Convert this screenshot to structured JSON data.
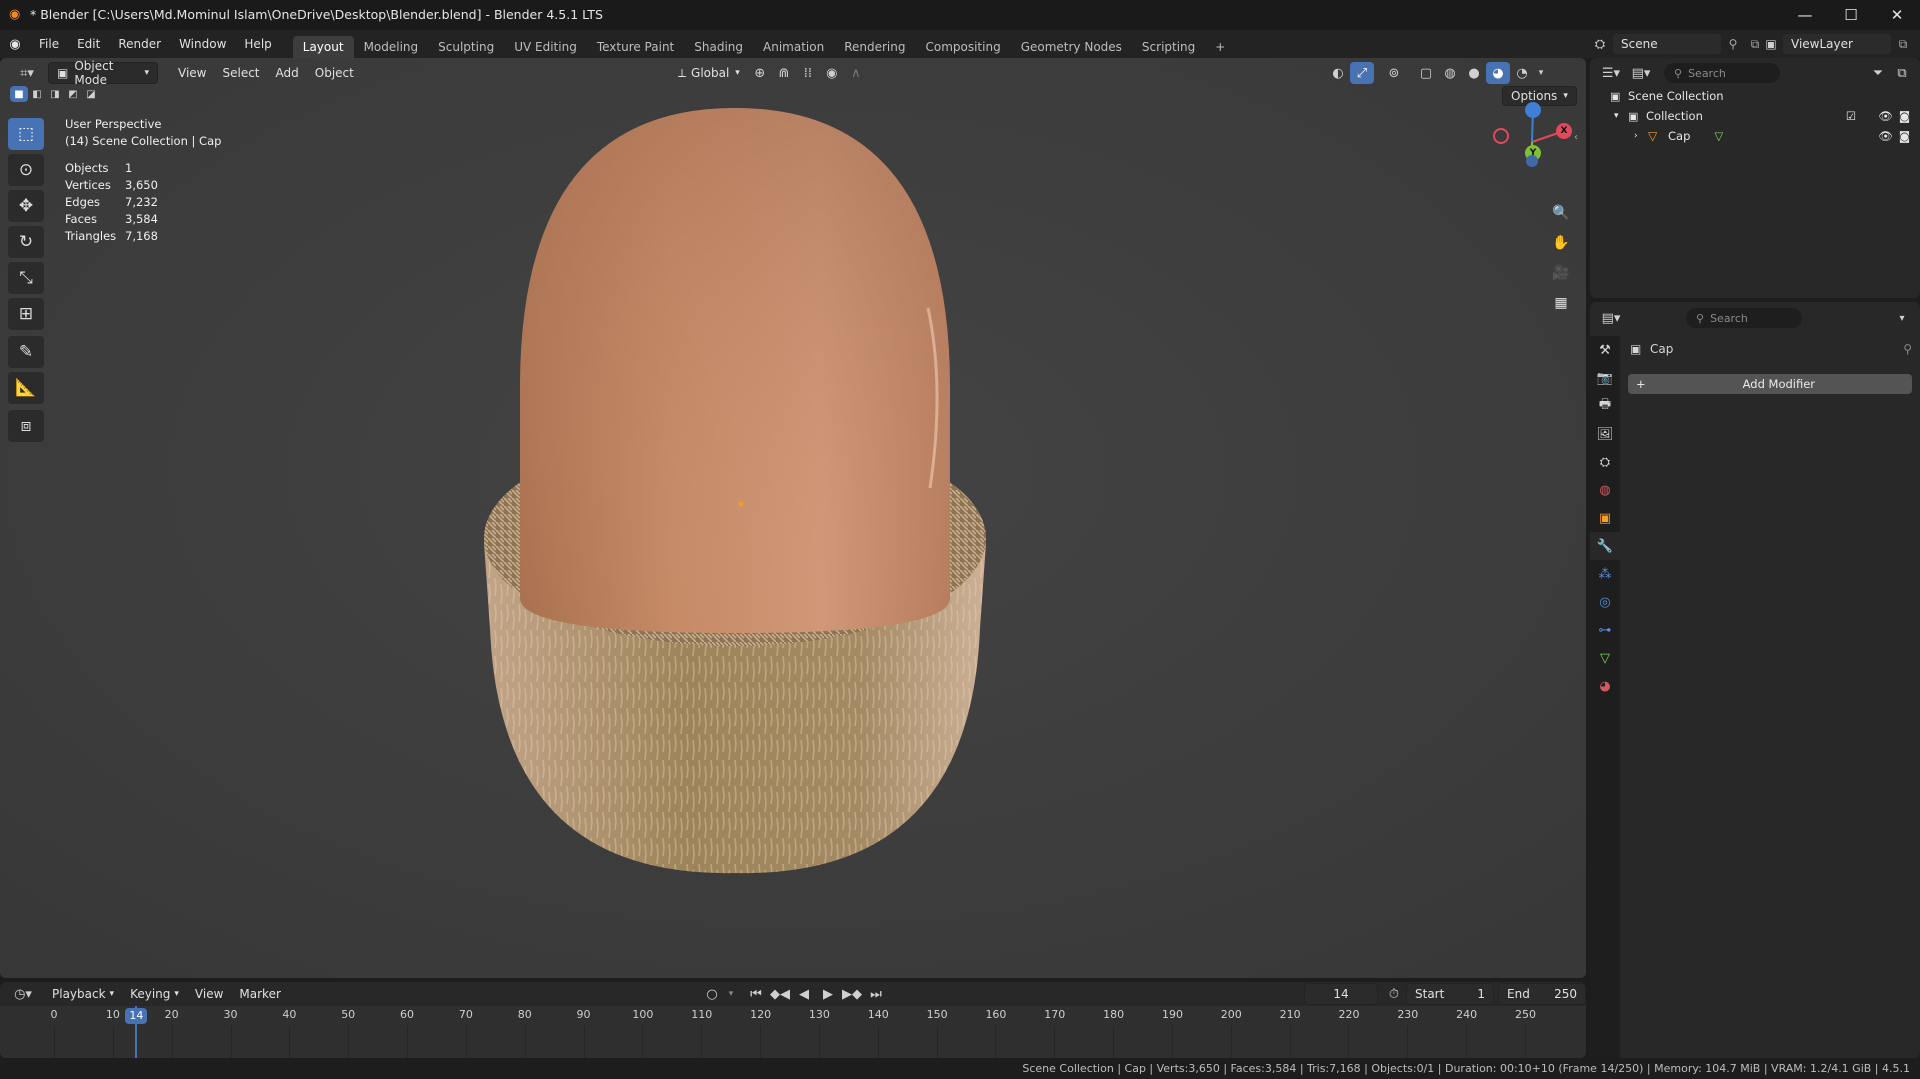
{
  "window": {
    "title": "* Blender [C:\\Users\\Md.Mominul Islam\\OneDrive\\Desktop\\Blender.blend] - Blender 4.5.1 LTS",
    "minimize": "—",
    "maximize": "☐",
    "close": "✕"
  },
  "menu": [
    "File",
    "Edit",
    "Render",
    "Window",
    "Help"
  ],
  "workspaces": [
    "Layout",
    "Modeling",
    "Sculpting",
    "UV Editing",
    "Texture Paint",
    "Shading",
    "Animation",
    "Rendering",
    "Compositing",
    "Geometry Nodes",
    "Scripting"
  ],
  "workspace_add": "+",
  "scene": {
    "label": "Scene",
    "view_layer": "ViewLayer"
  },
  "viewport": {
    "mode": "Object Mode",
    "menus": [
      "View",
      "Select",
      "Add",
      "Object"
    ],
    "transform_orientation": "Global",
    "options": "Options",
    "overlay_title": "User Perspective",
    "overlay_subtitle": "(14) Scene Collection | Cap",
    "stats": [
      {
        "k": "Objects",
        "v": "1"
      },
      {
        "k": "Vertices",
        "v": "3,650"
      },
      {
        "k": "Edges",
        "v": "7,232"
      },
      {
        "k": "Faces",
        "v": "3,584"
      },
      {
        "k": "Triangles",
        "v": "7,168"
      }
    ],
    "gizmo": {
      "x": "X",
      "y": "Y"
    }
  },
  "outliner": {
    "search_placeholder": "Search",
    "scene_collection": "Scene Collection",
    "collection": "Collection",
    "object": "Cap"
  },
  "properties": {
    "search_placeholder": "Search",
    "object_name": "Cap",
    "add_modifier": "Add Modifier"
  },
  "timeline": {
    "menus": [
      "Playback",
      "Keying",
      "View",
      "Marker"
    ],
    "current_frame": "14",
    "start_label": "Start",
    "start": "1",
    "end_label": "End",
    "end": "250",
    "ticks": [
      "0",
      "10",
      "20",
      "30",
      "40",
      "50",
      "60",
      "70",
      "80",
      "90",
      "100",
      "110",
      "120",
      "130",
      "140",
      "150",
      "160",
      "170",
      "180",
      "190",
      "200",
      "210",
      "220",
      "230",
      "240",
      "250"
    ],
    "playhead": "14"
  },
  "status": "Scene Collection | Cap | Verts:3,650 | Faces:3,584 | Tris:7,168 | Objects:0/1 | Duration: 00:10+10 (Frame 14/250) | Memory: 104.7 MiB | VRAM: 1.2/4.1 GiB | 4.5.1",
  "colors": {
    "accent": "#4772b3",
    "x_axis": "#e04a5a",
    "y_axis": "#7fbf3a",
    "z_axis": "#3f7fd6"
  }
}
